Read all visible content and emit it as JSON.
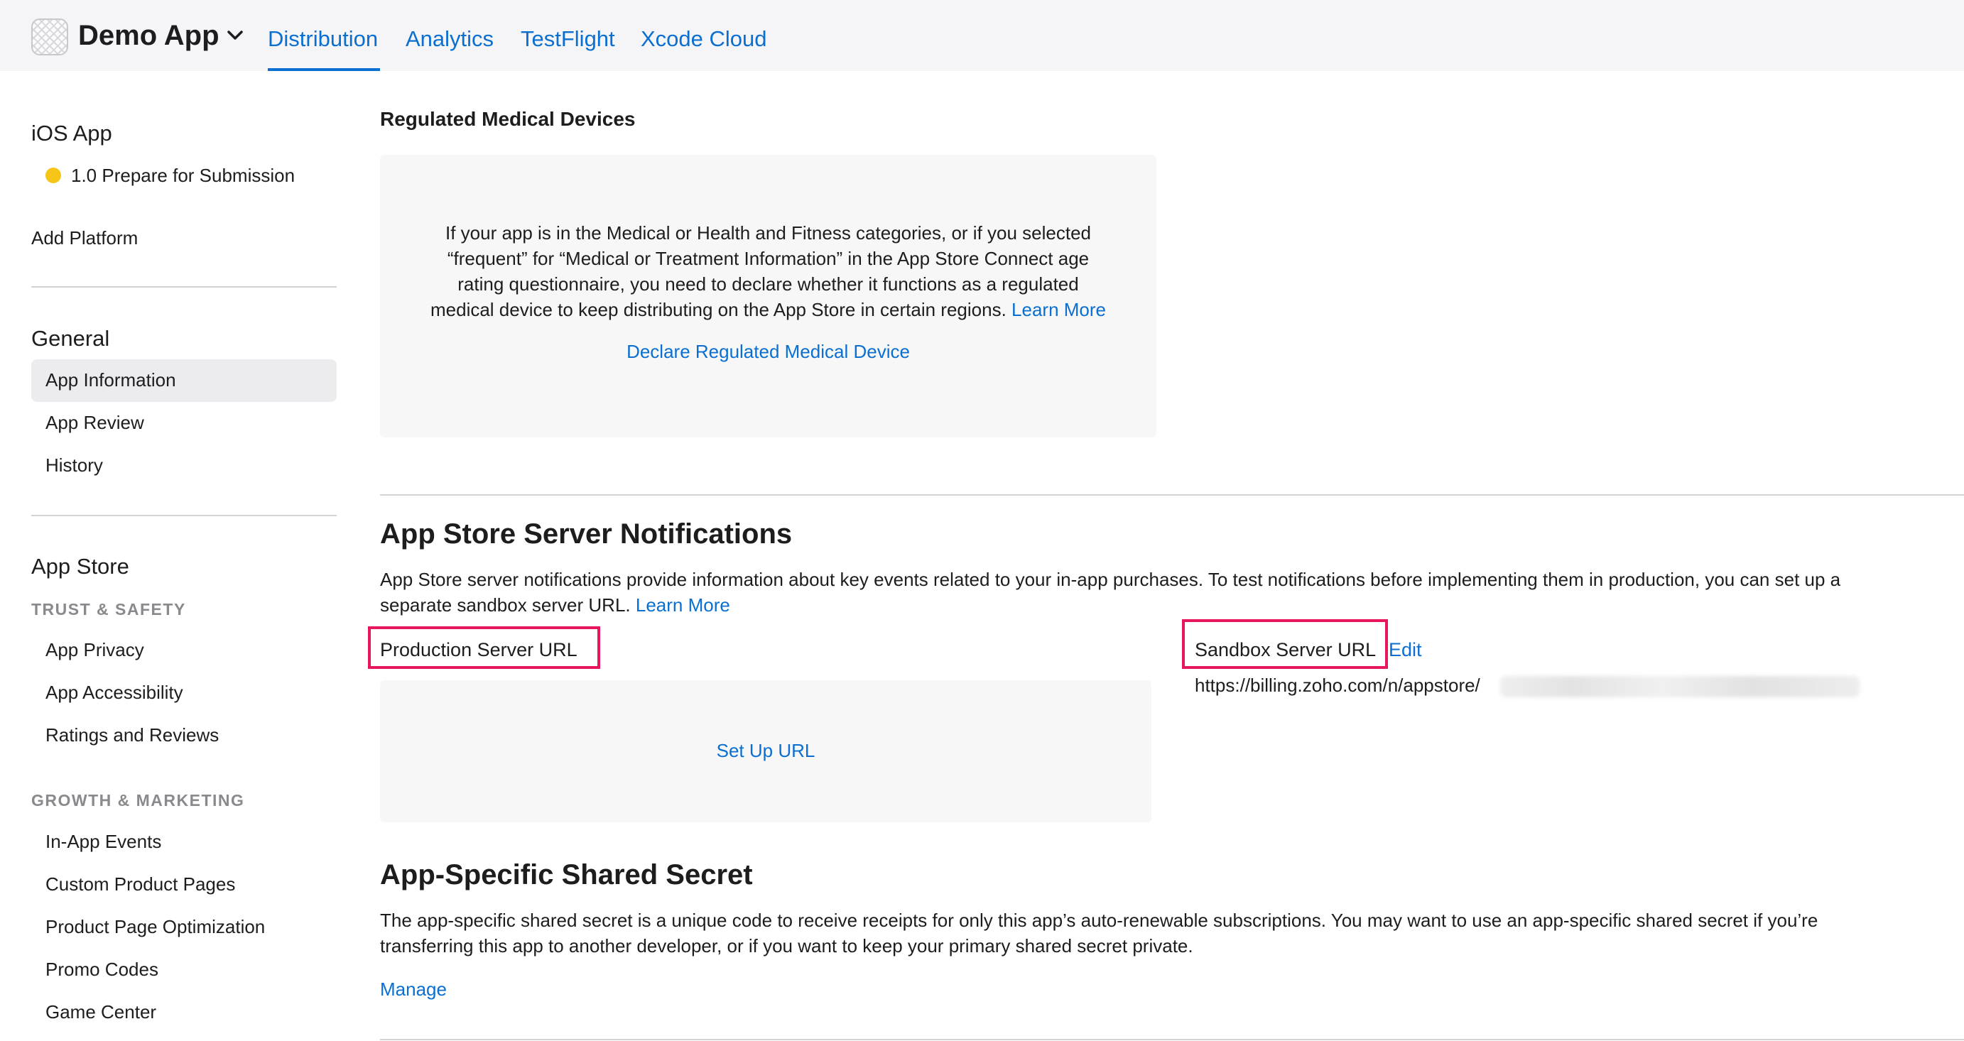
{
  "header": {
    "app_name": "Demo App",
    "tabs": [
      {
        "label": "Distribution",
        "active": true
      },
      {
        "label": "Analytics"
      },
      {
        "label": "TestFlight"
      },
      {
        "label": "Xcode Cloud"
      }
    ]
  },
  "sidebar": {
    "ios_app": {
      "heading": "iOS App",
      "version_status": "1.0 Prepare for Submission",
      "status_color": "#f5c518",
      "add_platform": "Add Platform"
    },
    "general": {
      "heading": "General",
      "items": [
        "App Information",
        "App Review",
        "History"
      ],
      "selected": "App Information"
    },
    "app_store": {
      "heading": "App Store",
      "trust_safety": {
        "label": "TRUST & SAFETY",
        "items": [
          "App Privacy",
          "App Accessibility",
          "Ratings and Reviews"
        ]
      },
      "growth_marketing": {
        "label": "GROWTH & MARKETING",
        "items": [
          "In-App Events",
          "Custom Product Pages",
          "Product Page Optimization",
          "Promo Codes",
          "Game Center"
        ]
      }
    }
  },
  "main": {
    "medical": {
      "title": "Regulated Medical Devices",
      "lines": [
        "If your app is in the Medical or Health and Fitness categories, or if you selected",
        "“frequent” for “Medical or Treatment Information” in the App Store Connect age",
        "rating questionnaire, you need to declare whether it functions as a regulated",
        "medical device to keep distributing on the App Store in certain regions."
      ],
      "learn_more": "Learn More",
      "action": "Declare Regulated Medical Device"
    },
    "notifications": {
      "title": "App Store Server Notifications",
      "line1": "App Store server notifications provide information about key events related to your in-app purchases. To test notifications before implementing them in production, you can set up a",
      "line2": "separate sandbox server URL.",
      "learn_more": "Learn More",
      "production_label": "Production Server URL",
      "setup_action": "Set Up URL",
      "sandbox_label": "Sandbox Server URL",
      "edit": "Edit",
      "sandbox_url": "https://billing.zoho.com/n/appstore/"
    },
    "shared_secret": {
      "title": "App-Specific Shared Secret",
      "line1": "The app-specific shared secret is a unique code to receive receipts for only this app’s auto-renewable subscriptions. You may want to use an app-specific shared secret if you’re",
      "line2": "transferring this app to another developer, or if you want to keep your primary shared secret private.",
      "manage": "Manage"
    }
  },
  "colors": {
    "accent": "#0a6fd1",
    "highlight": "#e8175d"
  }
}
